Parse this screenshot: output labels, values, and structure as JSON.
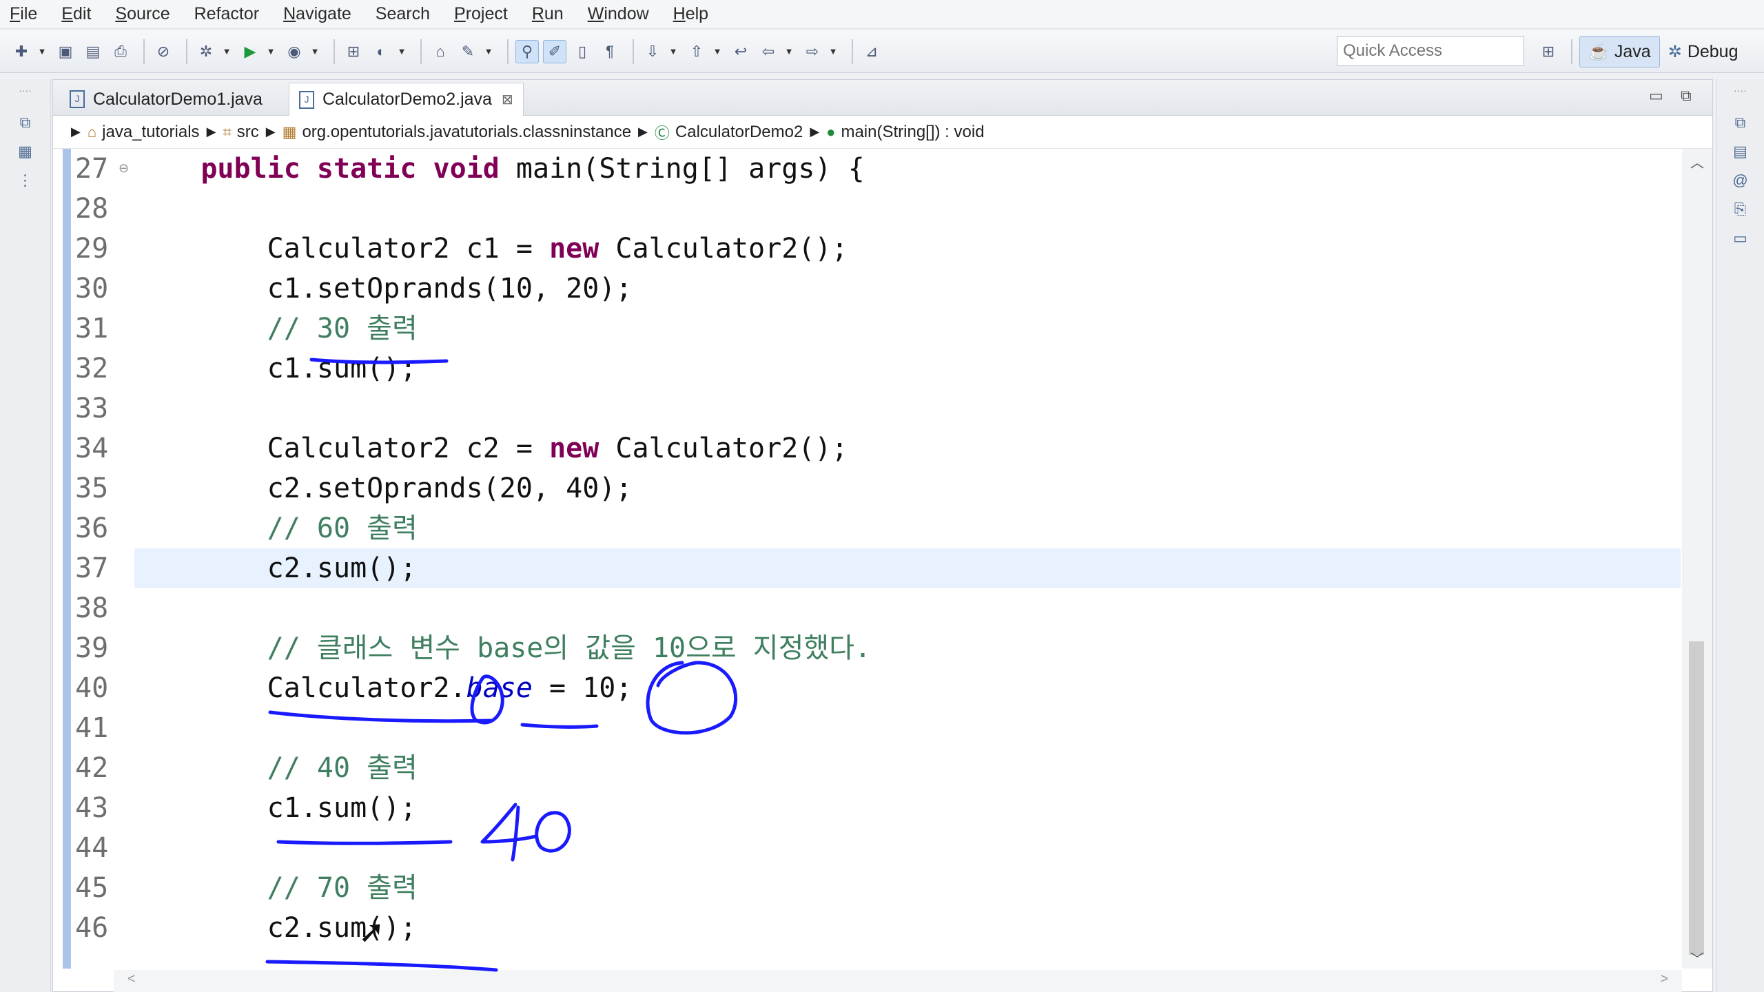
{
  "menu": {
    "items": [
      {
        "u": "F",
        "rest": "ile"
      },
      {
        "u": "E",
        "rest": "dit"
      },
      {
        "u": "S",
        "rest": "ource"
      },
      {
        "u": "",
        "rest": "Refactor"
      },
      {
        "u": "N",
        "rest": "avigate"
      },
      {
        "u": "",
        "rest": "Search"
      },
      {
        "u": "P",
        "rest": "roject"
      },
      {
        "u": "R",
        "rest": "un"
      },
      {
        "u": "W",
        "rest": "indow"
      },
      {
        "u": "H",
        "rest": "elp"
      }
    ]
  },
  "toolbar": {
    "quick_access_placeholder": "Quick Access",
    "perspectives": [
      {
        "label": "Java",
        "icon": "java-perspective-icon",
        "active": true
      },
      {
        "label": "Debug",
        "icon": "debug-perspective-icon",
        "active": false
      }
    ]
  },
  "editor": {
    "tabs": [
      {
        "label": "CalculatorDemo1.java",
        "active": false
      },
      {
        "label": "CalculatorDemo2.java",
        "active": true
      }
    ],
    "close_glyph": "⊠",
    "breadcrumb": [
      {
        "label": "java_tutorials",
        "icon": "project-icon"
      },
      {
        "label": "src",
        "icon": "source-folder-icon"
      },
      {
        "label": "org.opentutorials.javatutorials.classninstance",
        "icon": "package-icon"
      },
      {
        "label": "CalculatorDemo2",
        "icon": "class-icon"
      },
      {
        "label": "main(String[]) : void",
        "icon": "method-icon"
      }
    ],
    "lines": [
      {
        "n": "27",
        "fold": true,
        "parts": [
          [
            "",
            "    "
          ],
          [
            "kw",
            "public"
          ],
          [
            "",
            " "
          ],
          [
            "kw",
            "static"
          ],
          [
            "",
            " "
          ],
          [
            "kw",
            "void"
          ],
          [
            "",
            " main(String[] args) {"
          ]
        ]
      },
      {
        "n": "28",
        "parts": []
      },
      {
        "n": "29",
        "parts": [
          [
            "",
            "        Calculator2 c1 = "
          ],
          [
            "kw",
            "new"
          ],
          [
            "",
            " Calculator2();"
          ]
        ]
      },
      {
        "n": "30",
        "parts": [
          [
            "",
            "        c1.setOprands(10, 20);"
          ]
        ]
      },
      {
        "n": "31",
        "parts": [
          [
            "",
            "        "
          ],
          [
            "cm",
            "// 30 출력"
          ]
        ]
      },
      {
        "n": "32",
        "parts": [
          [
            "",
            "        c1.sum();"
          ]
        ]
      },
      {
        "n": "33",
        "parts": []
      },
      {
        "n": "34",
        "parts": [
          [
            "",
            "        Calculator2 c2 = "
          ],
          [
            "kw",
            "new"
          ],
          [
            "",
            " Calculator2();"
          ]
        ]
      },
      {
        "n": "35",
        "parts": [
          [
            "",
            "        c2.setOprands(20, 40);"
          ]
        ]
      },
      {
        "n": "36",
        "parts": [
          [
            "",
            "        "
          ],
          [
            "cm",
            "// 60 출력"
          ]
        ]
      },
      {
        "n": "37",
        "highlight": true,
        "parts": [
          [
            "",
            "        c2.sum();"
          ]
        ]
      },
      {
        "n": "38",
        "parts": []
      },
      {
        "n": "39",
        "parts": [
          [
            "",
            "        "
          ],
          [
            "cm",
            "// 클래스 변수 base의 값을 10으로 지정했다."
          ]
        ]
      },
      {
        "n": "40",
        "parts": [
          [
            "",
            "        Calculator2."
          ],
          [
            "fld",
            "base"
          ],
          [
            "",
            " = 10;"
          ]
        ]
      },
      {
        "n": "41",
        "parts": []
      },
      {
        "n": "42",
        "parts": [
          [
            "",
            "        "
          ],
          [
            "cm",
            "// 40 출력"
          ]
        ]
      },
      {
        "n": "43",
        "parts": [
          [
            "",
            "        c1.sum();"
          ]
        ]
      },
      {
        "n": "44",
        "parts": []
      },
      {
        "n": "45",
        "parts": [
          [
            "",
            "        "
          ],
          [
            "cm",
            "// 70 출력"
          ]
        ]
      },
      {
        "n": "46",
        "parts": [
          [
            "",
            "        c2.sum();"
          ]
        ]
      }
    ]
  },
  "annotations": {
    "handwritten_value": "40",
    "ink_color": "#1a1aff"
  }
}
